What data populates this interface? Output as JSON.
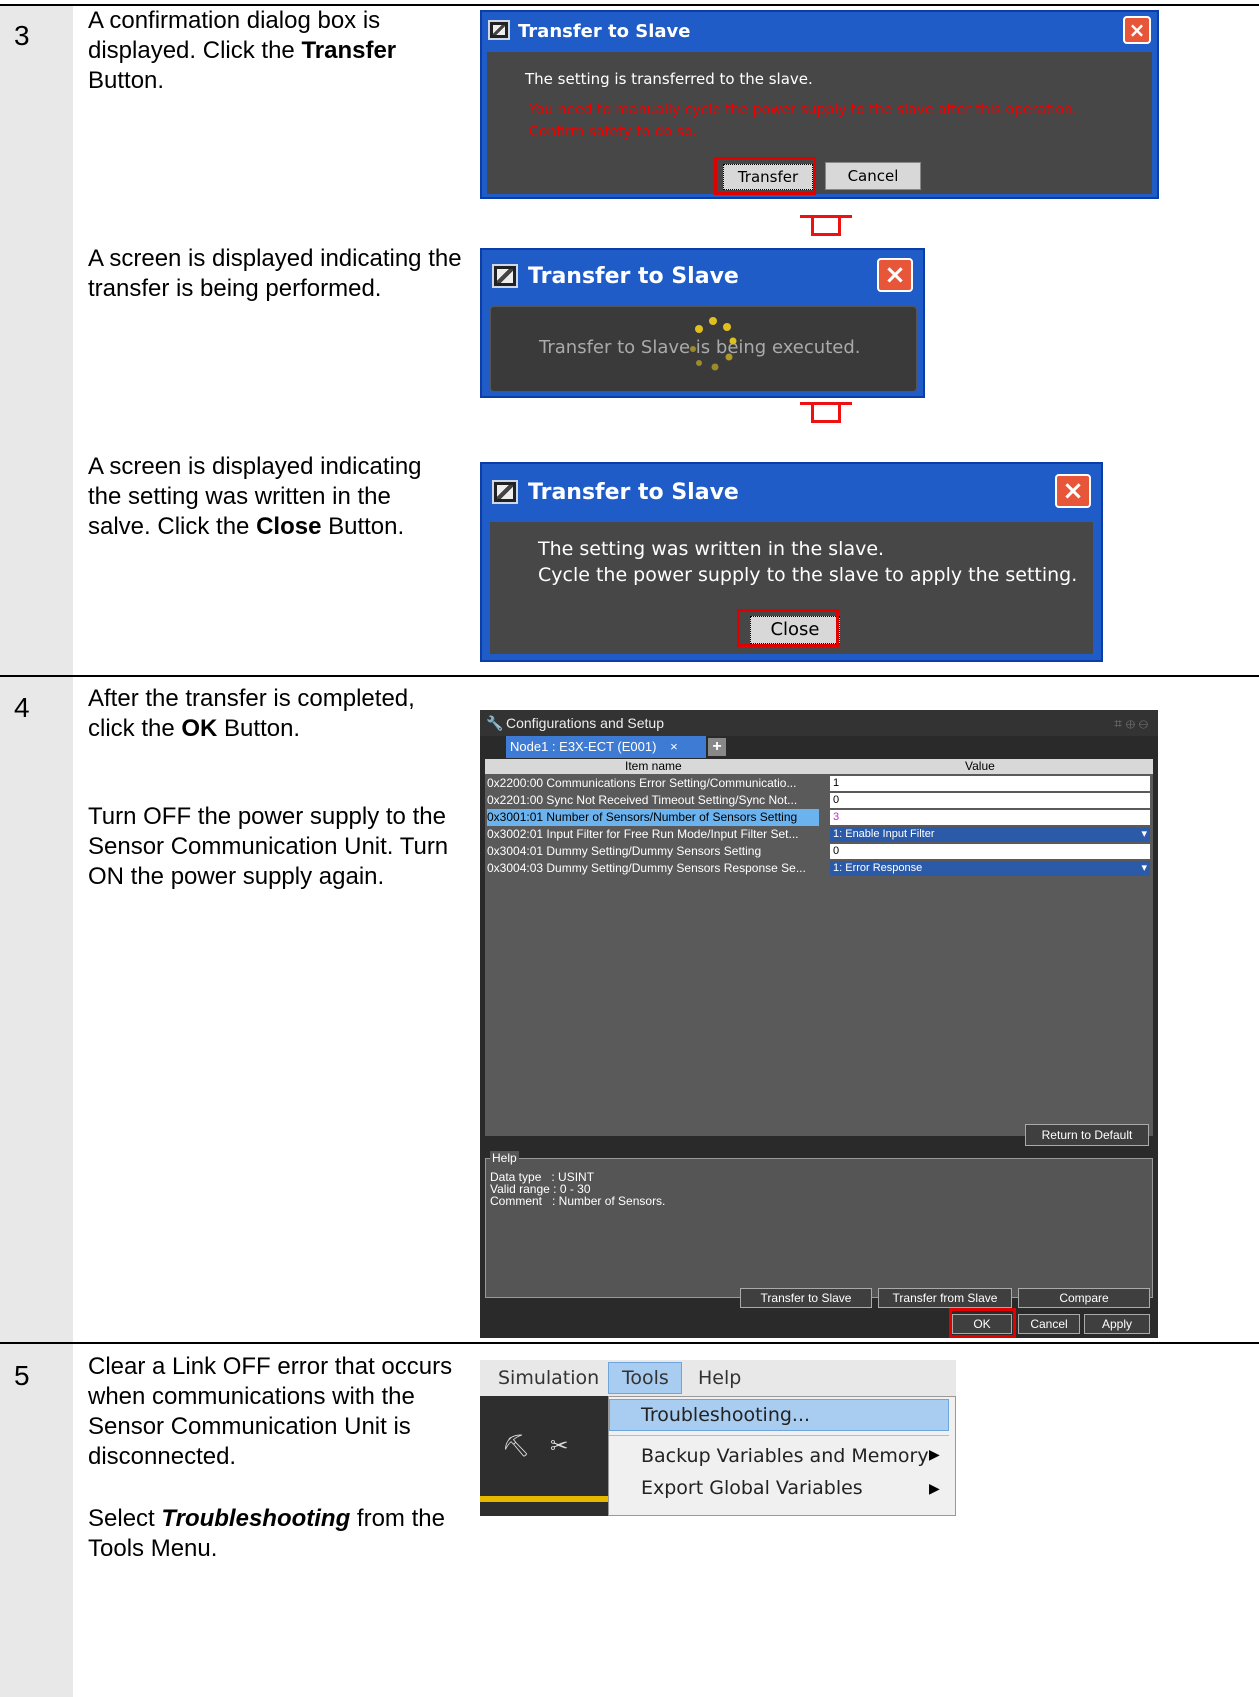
{
  "steps": {
    "s3": {
      "number": "3",
      "p1_a": "A confirmation dialog box is displayed. Click the ",
      "p1_b": "Transfer",
      "p1_c": " Button.",
      "p2": "A screen is displayed indicating the transfer is being performed.",
      "p3_a": "A screen is displayed indicating the setting was written in the salve. Click the ",
      "p3_b": "Close",
      "p3_c": " Button."
    },
    "s4": {
      "number": "4",
      "p1_a": "After the transfer is completed, click the ",
      "p1_b": "OK",
      "p1_c": " Button.",
      "p2": "Turn OFF the power supply to the Sensor Communication Unit. Turn ON the power supply again."
    },
    "s5": {
      "number": "5",
      "p1": "Clear a Link OFF error that occurs when communications with the Sensor Communication Unit is disconnected.",
      "p2_a": "Select ",
      "p2_b": "Troubleshooting",
      "p2_c": " from the Tools Menu."
    }
  },
  "dialog1": {
    "title": "Transfer to Slave",
    "close": "×",
    "message": "The setting is transferred to the slave.",
    "warning_line1": "You need to manually cycle the power supply to the slave after this operation.",
    "warning_line2": "Confirm safety to do so.",
    "transfer_button": "Transfer",
    "cancel_button": "Cancel"
  },
  "dialog2": {
    "title": "Transfer to Slave",
    "close": "×",
    "message": "Transfer to Slave is being executed."
  },
  "dialog3": {
    "title": "Transfer to Slave",
    "close": "×",
    "message_line1": "The setting was written in the slave.",
    "message_line2": "Cycle the power supply to the slave to apply the setting.",
    "close_button": "Close"
  },
  "config": {
    "title": "Configurations and Setup",
    "tab": "Node1 : E3X-ECT (E001)",
    "tab_close": "×",
    "add_tab": "+",
    "col_item": "Item name",
    "col_value": "Value",
    "rows": [
      {
        "name": "0x2200:00 Communications Error Setting/Communicatio...",
        "value": "1"
      },
      {
        "name": "0x2201:00 Sync Not Received Timeout Setting/Sync Not...",
        "value": "0"
      },
      {
        "name": "0x3001:01 Number of Sensors/Number of Sensors Setting",
        "value": "3"
      },
      {
        "name": "0x3002:01 Input Filter for Free Run Mode/Input Filter Set...",
        "value": "1: Enable Input Filter"
      },
      {
        "name": "0x3004:01 Dummy Setting/Dummy Sensors Setting",
        "value": "0"
      },
      {
        "name": "0x3004:03 Dummy Setting/Dummy Sensors Response Se...",
        "value": "1: Error Response"
      }
    ],
    "return_default": "Return to Default",
    "help_label": "Help",
    "help_line1": "Data type   : USINT",
    "help_line2": "Valid range : 0 - 30",
    "help_line3": "Comment   : Number of Sensors.",
    "transfer_to_slave": "Transfer to Slave",
    "transfer_from_slave": "Transfer from Slave",
    "compare": "Compare",
    "ok": "OK",
    "cancel": "Cancel",
    "apply": "Apply"
  },
  "menu": {
    "bar": [
      "Simulation",
      "Tools",
      "Help"
    ],
    "items": {
      "troubleshooting": "Troubleshooting...",
      "backup": "Backup Variables and Memory",
      "export": "Export Global Variables"
    }
  }
}
